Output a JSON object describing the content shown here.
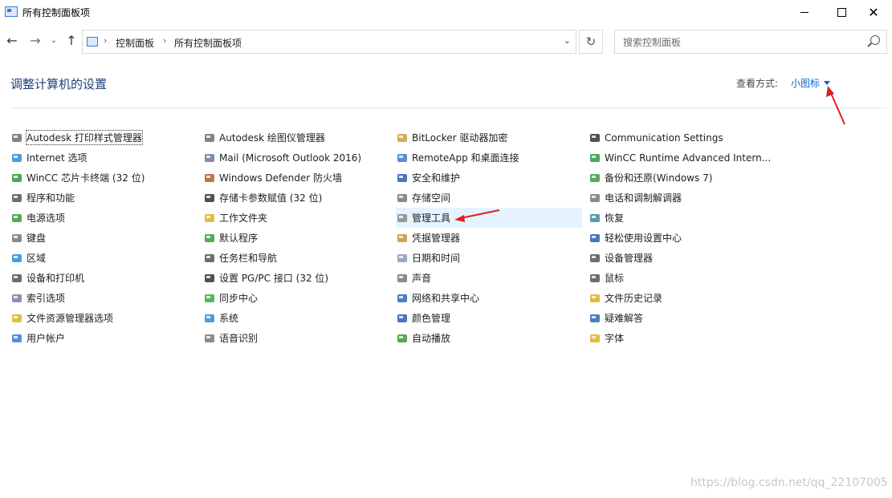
{
  "window": {
    "title": "所有控制面板项"
  },
  "address": {
    "breadcrumbs": [
      "控制面板",
      "所有控制面板项"
    ]
  },
  "search": {
    "placeholder": "搜索控制面板"
  },
  "header": {
    "title": "调整计算机的设置",
    "view_label": "查看方式:",
    "view_value": "小图标"
  },
  "columns": [
    [
      {
        "label": "Autodesk 打印样式管理器",
        "icon": "printer-icon",
        "color": "#6e6e6e"
      },
      {
        "label": "Internet 选项",
        "icon": "globe-icon",
        "color": "#2a8cd8"
      },
      {
        "label": "WinCC 芯片卡终端 (32 位)",
        "icon": "wincc-icon",
        "color": "#2c9a3a"
      },
      {
        "label": "程序和功能",
        "icon": "programs-icon",
        "color": "#555555"
      },
      {
        "label": "电源选项",
        "icon": "power-icon",
        "color": "#3a9a3a"
      },
      {
        "label": "键盘",
        "icon": "keyboard-icon",
        "color": "#777777"
      },
      {
        "label": "区域",
        "icon": "region-icon",
        "color": "#2a8cd8"
      },
      {
        "label": "设备和打印机",
        "icon": "devices-icon",
        "color": "#555555"
      },
      {
        "label": "索引选项",
        "icon": "index-icon",
        "color": "#7a7aaa"
      },
      {
        "label": "文件资源管理器选项",
        "icon": "folder-options-icon",
        "color": "#e0b020"
      },
      {
        "label": "用户帐户",
        "icon": "users-icon",
        "color": "#3a7bd5"
      }
    ],
    [
      {
        "label": "Autodesk 绘图仪管理器",
        "icon": "plotter-icon",
        "color": "#6e6e6e"
      },
      {
        "label": "Mail (Microsoft Outlook 2016)",
        "icon": "mail-icon",
        "color": "#6a7a9a"
      },
      {
        "label": "Windows Defender 防火墙",
        "icon": "firewall-icon",
        "color": "#b85a2a"
      },
      {
        "label": "存储卡参数赋值 (32 位)",
        "icon": "storage-card-icon",
        "color": "#333333"
      },
      {
        "label": "工作文件夹",
        "icon": "work-folders-icon",
        "color": "#e0b020"
      },
      {
        "label": "默认程序",
        "icon": "default-programs-icon",
        "color": "#3a9a3a"
      },
      {
        "label": "任务栏和导航",
        "icon": "taskbar-icon",
        "color": "#555555"
      },
      {
        "label": "设置 PG/PC 接口 (32 位)",
        "icon": "pgpc-icon",
        "color": "#333333"
      },
      {
        "label": "同步中心",
        "icon": "sync-icon",
        "color": "#3aaa3a"
      },
      {
        "label": "系统",
        "icon": "system-icon",
        "color": "#2a8cd8"
      },
      {
        "label": "语音识别",
        "icon": "microphone-icon",
        "color": "#777777"
      }
    ],
    [
      {
        "label": "BitLocker 驱动器加密",
        "icon": "bitlocker-icon",
        "color": "#c8a040"
      },
      {
        "label": "RemoteApp 和桌面连接",
        "icon": "remoteapp-icon",
        "color": "#3a7bd5"
      },
      {
        "label": "安全和维护",
        "icon": "flag-icon",
        "color": "#2a5ab8"
      },
      {
        "label": "存储空间",
        "icon": "storage-spaces-icon",
        "color": "#777777"
      },
      {
        "label": "管理工具",
        "icon": "admin-tools-icon",
        "color": "#888888",
        "hover": true
      },
      {
        "label": "凭据管理器",
        "icon": "credential-icon",
        "color": "#c89030"
      },
      {
        "label": "日期和时间",
        "icon": "clock-icon",
        "color": "#8a9ab0"
      },
      {
        "label": "声音",
        "icon": "speaker-icon",
        "color": "#777777"
      },
      {
        "label": "网络和共享中心",
        "icon": "network-icon",
        "color": "#2a6ab8"
      },
      {
        "label": "颜色管理",
        "icon": "color-management-icon",
        "color": "#2a5ab8"
      },
      {
        "label": "自动播放",
        "icon": "autoplay-icon",
        "color": "#3a9a3a"
      }
    ],
    [
      {
        "label": "Communication Settings",
        "icon": "com-settings-icon",
        "color": "#333333"
      },
      {
        "label": "WinCC Runtime Advanced Intern...",
        "icon": "wincc-runtime-icon",
        "color": "#2c9a3a"
      },
      {
        "label": "备份和还原(Windows 7)",
        "icon": "backup-icon",
        "color": "#3a9a3a"
      },
      {
        "label": "电话和调制解调器",
        "icon": "phone-modem-icon",
        "color": "#777777"
      },
      {
        "label": "恢复",
        "icon": "recovery-icon",
        "color": "#3a8a9a"
      },
      {
        "label": "轻松使用设置中心",
        "icon": "ease-of-access-icon",
        "color": "#2a5ab8"
      },
      {
        "label": "设备管理器",
        "icon": "device-manager-icon",
        "color": "#555555"
      },
      {
        "label": "鼠标",
        "icon": "mouse-icon",
        "color": "#555555"
      },
      {
        "label": "文件历史记录",
        "icon": "file-history-icon",
        "color": "#e0b020"
      },
      {
        "label": "疑难解答",
        "icon": "troubleshoot-icon",
        "color": "#2a6ab8"
      },
      {
        "label": "字体",
        "icon": "fonts-icon",
        "color": "#e0b020"
      }
    ]
  ],
  "watermark": "https://blog.csdn.net/qq_22107005",
  "colors": {
    "link": "#0a64c8",
    "title": "#1f3f7a",
    "annotation": "#e02020",
    "hover_bg": "#e5f3ff"
  }
}
